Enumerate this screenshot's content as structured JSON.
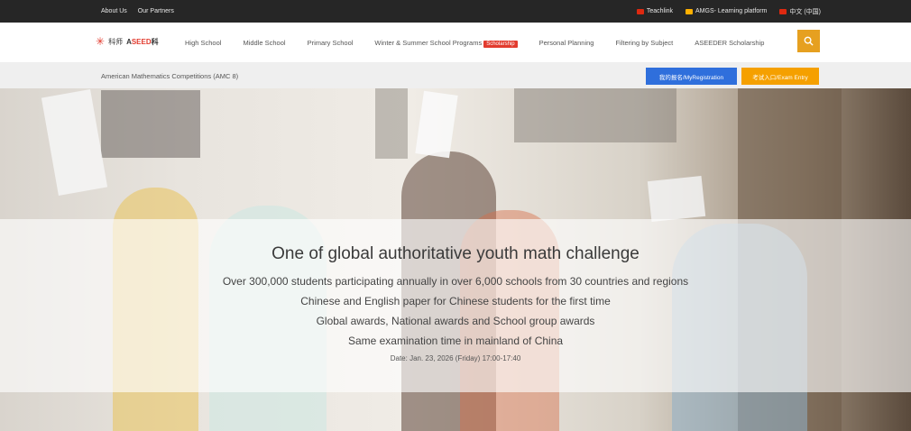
{
  "topbar": {
    "about": "About Us",
    "partners": "Our Partners",
    "teachlink": "Teachlink",
    "amgs": "AMGS- Learning platform",
    "lang": "中文 (中国)"
  },
  "nav": {
    "logo_cn": "科师",
    "logo_brand_a": "A",
    "logo_brand_seed": "SEED",
    "logo_brand_tail": "科",
    "items": [
      "High School",
      "Middle School",
      "Primary School",
      "Winter & Summer School Programs",
      "Personal Planning",
      "Filtering by Subject",
      "ASEEDER Scholarship"
    ],
    "badge": "Scholarship"
  },
  "subbar": {
    "crumb": "American Mathematics Competitions (AMC 8)",
    "register": "我的报名/MyRegistration",
    "exam_entry": "考试入口/Exam Entry"
  },
  "hero": {
    "title": "One of global authoritative youth math challenge",
    "lines": [
      "Over 300,000 students participating annually in over 6,000 schools from 30 countries and regions",
      "Chinese and English paper for Chinese students for the first time",
      "Global awards, National awards and School group awards",
      "Same examination time in mainland of China"
    ],
    "date": "Date: Jan. 23, 2026 (Friday) 17:00-17:40"
  },
  "colors": {
    "topbar": "#262626",
    "accent_orange": "#e6a020",
    "register_blue": "#2f6fdc",
    "exam_orange": "#f5a000",
    "badge_red": "#e23b2e"
  },
  "icons": {
    "search": "search-icon",
    "logo": "asterisk-logo-icon"
  }
}
